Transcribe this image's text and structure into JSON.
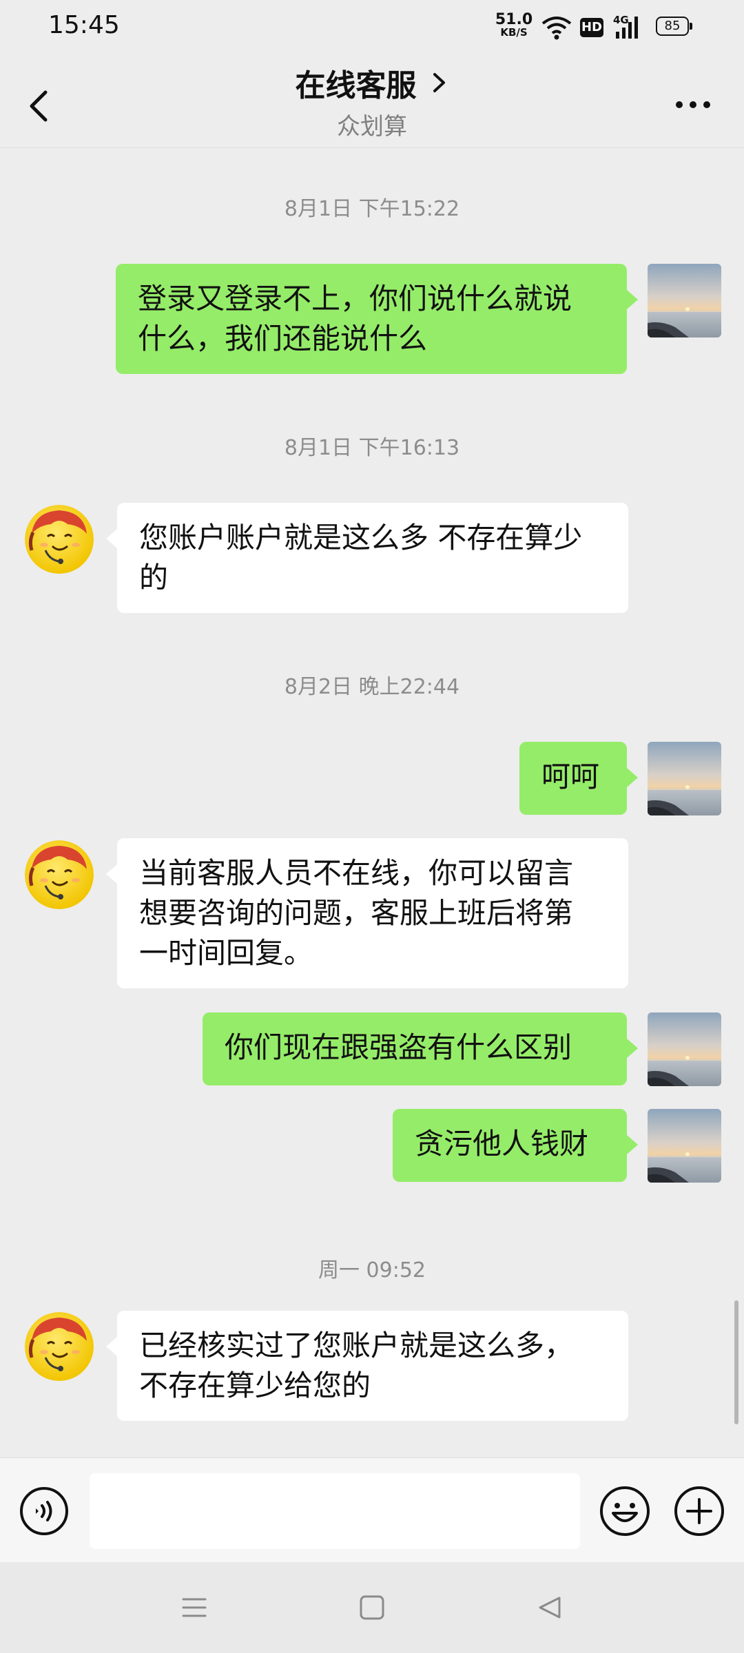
{
  "status_bar": {
    "time": "15:45",
    "net_speed": "51.0",
    "net_unit": "KB/S",
    "hd_badge": "HD",
    "network_type": "4G",
    "battery": "85"
  },
  "header": {
    "title": "在线客服",
    "subtitle": "众划算"
  },
  "messages": [
    {
      "type": "timestamp",
      "text": "8月1日 下午15:22"
    },
    {
      "type": "outgoing",
      "lines": [
        "登录又登录不上，你们说什么就说",
        "什么，我们还能说什么"
      ]
    },
    {
      "type": "timestamp",
      "text": "8月1日 下午16:13"
    },
    {
      "type": "incoming",
      "lines": [
        "您账户账户就是这么多 不存在算少",
        "的"
      ]
    },
    {
      "type": "timestamp",
      "text": "8月2日 晚上22:44"
    },
    {
      "type": "outgoing",
      "lines": [
        "呵呵"
      ]
    },
    {
      "type": "incoming",
      "lines": [
        "当前客服人员不在线，你可以留言",
        "想要咨询的问题，客服上班后将第",
        "一时间回复。"
      ]
    },
    {
      "type": "outgoing",
      "lines": [
        "你们现在跟强盗有什么区别"
      ]
    },
    {
      "type": "outgoing",
      "lines": [
        "贪污他人钱财"
      ]
    },
    {
      "type": "timestamp",
      "text": "周一 09:52"
    },
    {
      "type": "incoming",
      "lines": [
        "已经核实过了您账户就是这么多，",
        "不存在算少给您的"
      ]
    }
  ],
  "input": {
    "value": "",
    "placeholder": ""
  },
  "colors": {
    "outgoing_bubble": "#95ec69",
    "incoming_bubble": "#ffffff",
    "background": "#ededed"
  },
  "icons": {
    "back": "chevron-left-icon",
    "title_arrow": "chevron-right-icon",
    "more": "more-dots-icon",
    "voice": "voice-icon",
    "emoji": "emoji-icon",
    "plus": "plus-icon",
    "nav_menu": "menu-icon",
    "nav_home": "home-square-icon",
    "nav_back": "triangle-back-icon"
  }
}
